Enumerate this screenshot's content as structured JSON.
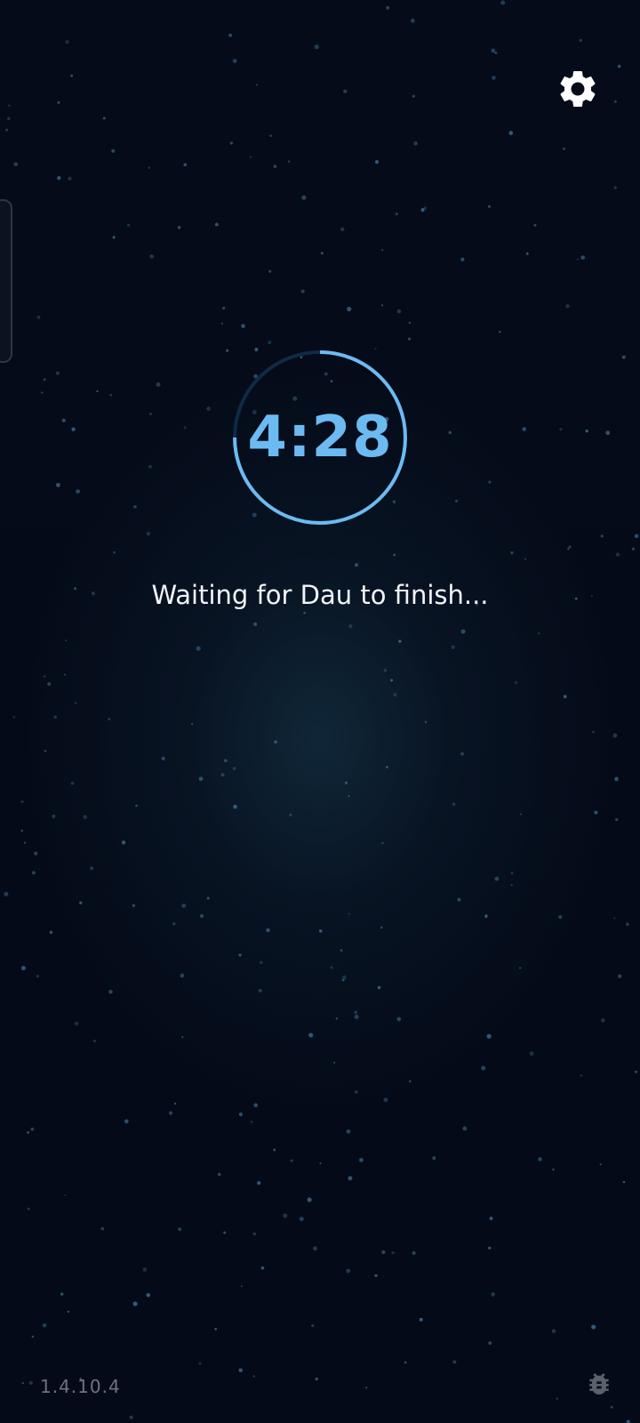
{
  "timer": {
    "time_remaining": "4:28",
    "progress_fraction": 0.75
  },
  "status": {
    "message": "Waiting for Dau to finish..."
  },
  "footer": {
    "version": "1.4.10.4"
  },
  "icons": {
    "settings": "gear-icon",
    "bug_report": "bug-icon"
  },
  "colors": {
    "background": "#040a18",
    "accent": "#6cbaf2",
    "track": "#0f2a45",
    "text": "#f2f5f8",
    "muted": "#6c7480"
  }
}
